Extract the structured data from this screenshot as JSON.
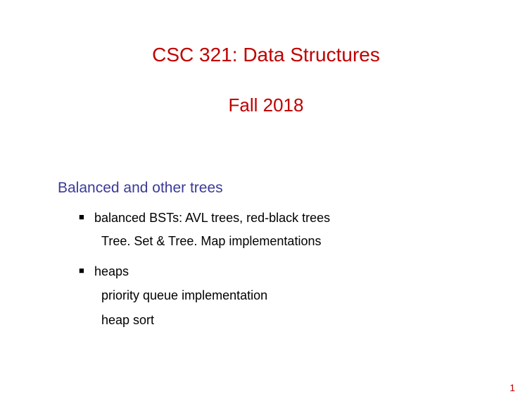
{
  "title": "CSC 321: Data Structures",
  "subtitle": "Fall 2018",
  "section_heading": "Balanced and other trees",
  "bullets": [
    {
      "main": "balanced BSTs: AVL trees, red-black trees",
      "subs": [
        "Tree. Set & Tree. Map implementations"
      ]
    },
    {
      "main": "heaps",
      "subs": [
        "priority queue implementation",
        "heap sort"
      ]
    }
  ],
  "page_number": "1"
}
